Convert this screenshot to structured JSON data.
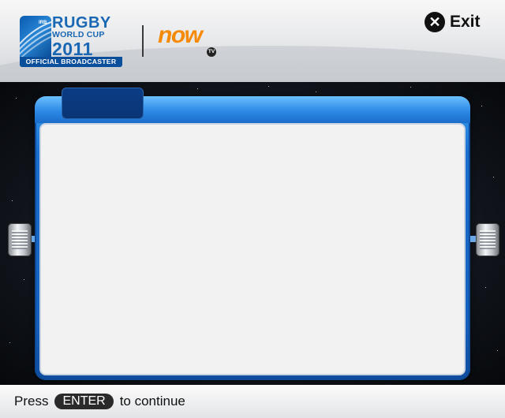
{
  "header": {
    "rugby_logo": {
      "line1": "RUGBY",
      "line2": "WORLD CUP",
      "year": "2011",
      "banner": "OFFICIAL BROADCASTER",
      "mark_text": "IRB"
    },
    "partner_logo": {
      "word": "now",
      "badge": "TV"
    },
    "exit": {
      "icon": "close-icon",
      "label": "Exit"
    }
  },
  "panel": {
    "tab_label": "",
    "body_text": ""
  },
  "footer": {
    "prefix": "Press",
    "key": "ENTER",
    "suffix": "to continue"
  },
  "colors": {
    "accent_blue": "#1a6fd0",
    "now_orange": "#f58a07"
  }
}
